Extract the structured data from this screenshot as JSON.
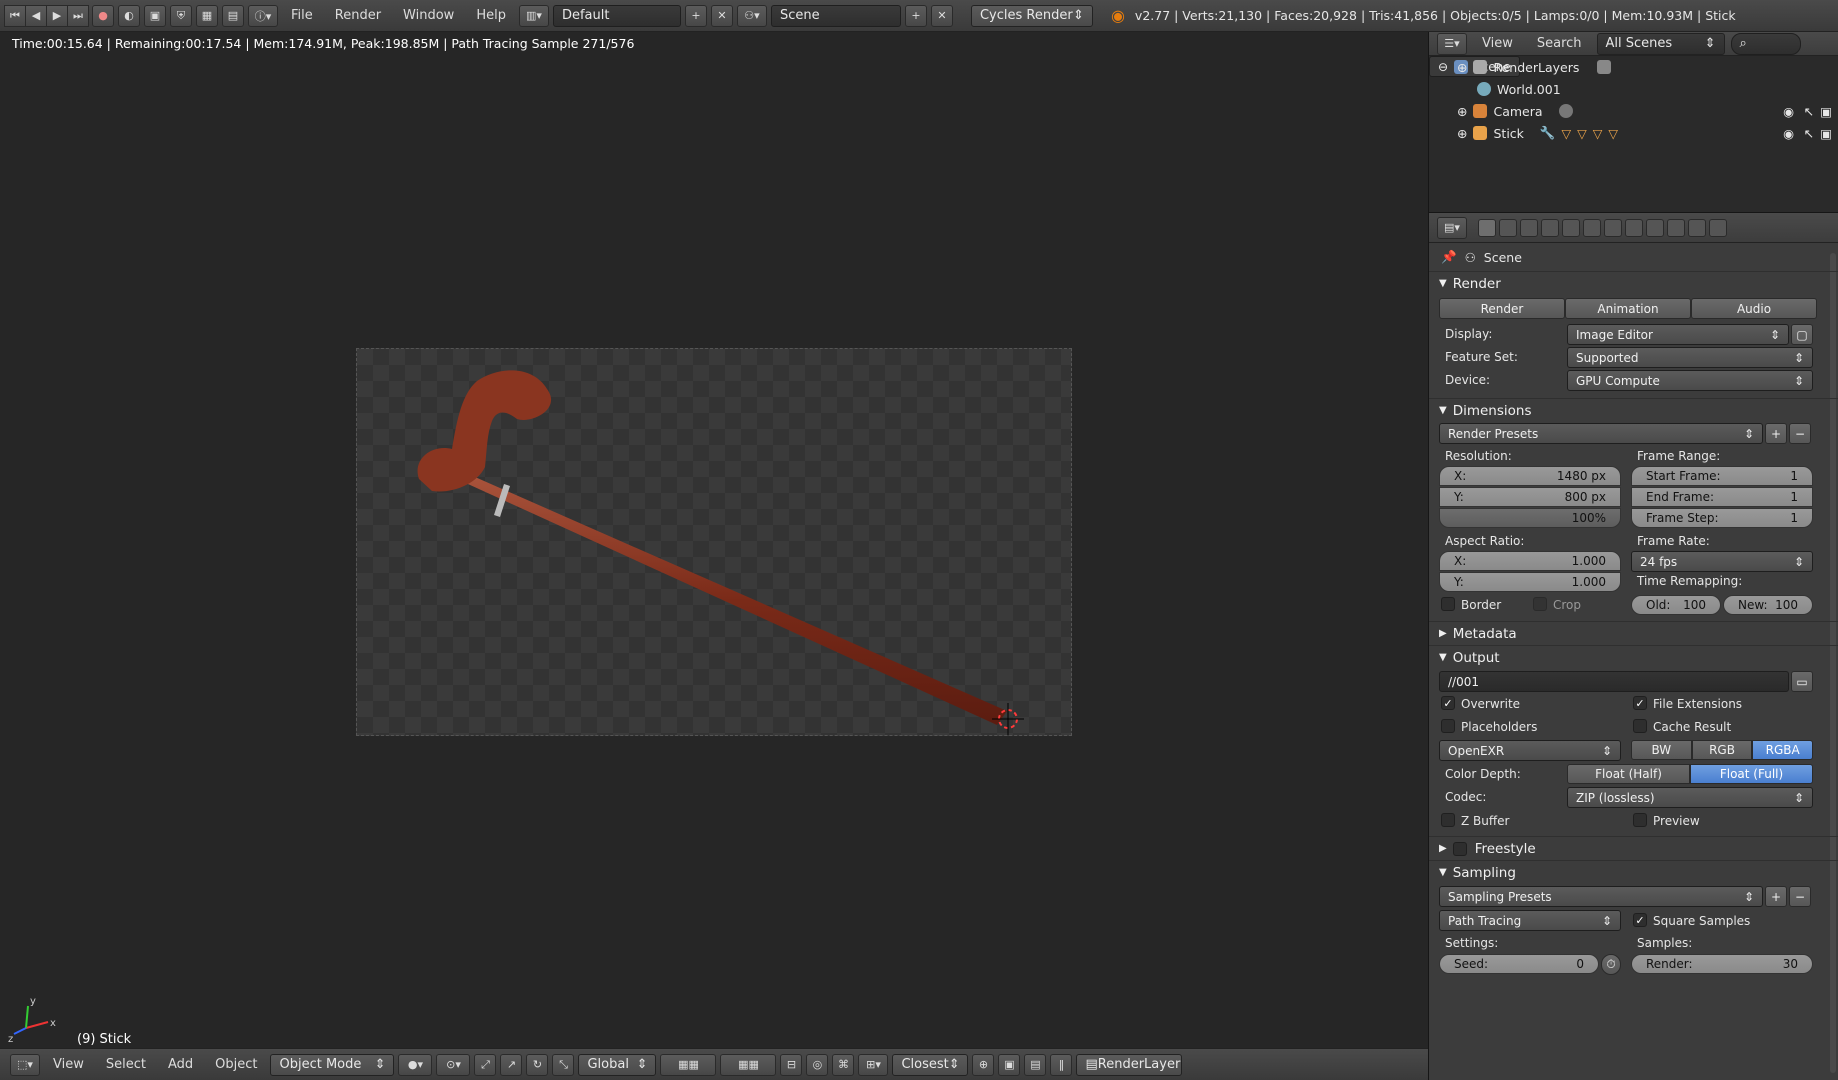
{
  "topbar": {
    "menus": [
      "File",
      "Render",
      "Window",
      "Help"
    ],
    "layout": "Default",
    "scene": "Scene",
    "engine": "Cycles Render",
    "stats": "v2.77 | Verts:21,130 | Faces:20,928 | Tris:41,856 | Objects:0/5 | Lamps:0/0 | Mem:10.93M | Stick"
  },
  "viewport": {
    "status": "Time:00:15.64 | Remaining:00:17.54 | Mem:174.91M, Peak:198.85M | Path Tracing Sample 271/576",
    "object_label": "(9) Stick",
    "axes": {
      "x": "x",
      "y": "y",
      "z": "z"
    }
  },
  "bottombar": {
    "menus": [
      "View",
      "Select",
      "Add",
      "Object"
    ],
    "mode": "Object Mode",
    "orientation": "Global",
    "snap": "Closest",
    "layer": "RenderLayer"
  },
  "outliner": {
    "view": "View",
    "search": "Search",
    "filter": "All Scenes",
    "items": [
      {
        "label": "Scene"
      },
      {
        "label": "RenderLayers"
      },
      {
        "label": "World.001"
      },
      {
        "label": "Camera"
      },
      {
        "label": "Stick"
      }
    ]
  },
  "props": {
    "context": "Scene",
    "render": {
      "title": "Render",
      "btn_render": "Render",
      "btn_animation": "Animation",
      "btn_audio": "Audio",
      "display_label": "Display:",
      "display": "Image Editor",
      "featureset_label": "Feature Set:",
      "featureset": "Supported",
      "device_label": "Device:",
      "device": "GPU Compute"
    },
    "dimensions": {
      "title": "Dimensions",
      "presets": "Render Presets",
      "resolution_label": "Resolution:",
      "res_x_label": "X:",
      "res_x": "1480 px",
      "res_y_label": "Y:",
      "res_y": "800 px",
      "res_pct": "100%",
      "frame_range_label": "Frame Range:",
      "start_label": "Start Frame:",
      "start": "1",
      "end_label": "End Frame:",
      "end": "1",
      "step_label": "Frame Step:",
      "step": "1",
      "aspect_label": "Aspect Ratio:",
      "aspect_x_label": "X:",
      "aspect_x": "1.000",
      "aspect_y_label": "Y:",
      "aspect_y": "1.000",
      "frame_rate_label": "Frame Rate:",
      "frame_rate": "24 fps",
      "time_remap_label": "Time Remapping:",
      "old_label": "Old:",
      "old": "100",
      "new_label": "New:",
      "new": "100",
      "border": "Border",
      "crop": "Crop"
    },
    "metadata": {
      "title": "Metadata"
    },
    "output": {
      "title": "Output",
      "path": "//001",
      "overwrite": "Overwrite",
      "file_ext": "File Extensions",
      "placeholders": "Placeholders",
      "cache": "Cache Result",
      "format": "OpenEXR",
      "bw": "BW",
      "rgb": "RGB",
      "rgba": "RGBA",
      "depth_label": "Color Depth:",
      "depth_half": "Float (Half)",
      "depth_full": "Float (Full)",
      "codec_label": "Codec:",
      "codec": "ZIP (lossless)",
      "zbuffer": "Z Buffer",
      "preview": "Preview"
    },
    "freestyle": {
      "title": "Freestyle"
    },
    "sampling": {
      "title": "Sampling",
      "presets": "Sampling Presets",
      "integrator": "Path Tracing",
      "square": "Square Samples",
      "settings_label": "Settings:",
      "samples_label": "Samples:",
      "seed_label": "Seed:",
      "seed": "0",
      "render_label": "Render:",
      "render": "30"
    }
  }
}
